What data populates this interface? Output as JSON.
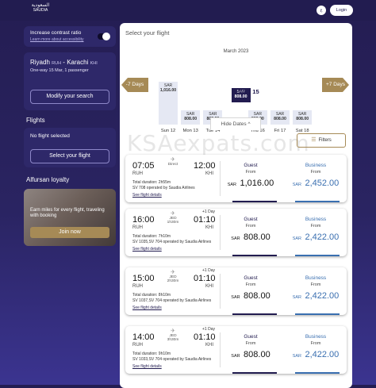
{
  "header": {
    "logo_ar": "السعودية",
    "logo_en": "SAUDIA",
    "lang_label": "ع",
    "login_label": "Login"
  },
  "sidebar": {
    "contrast_label": "Increase contrast ratio",
    "accessibility_link": "Learn more about accessibility",
    "route_from": "Riyadh",
    "route_from_code": "RUH",
    "route_sep": "-",
    "route_to": "Karachi",
    "route_to_code": "KHI",
    "trip_info": "One-way 15 Mar, 1 passenger",
    "modify_label": "Modify your search",
    "flights_title": "Flights",
    "no_flight": "No flight selected",
    "select_flight_btn": "Select your flight",
    "loyalty_title": "Alfursan loyalty",
    "loyalty_text": "Earn miles for every flight, traveling with booking",
    "join_label": "Join now"
  },
  "main": {
    "title": "Select your flight",
    "month": "March 2023",
    "prev_label": "-7 Days",
    "next_label": "+7 Days",
    "hide_dates": "Hide Dates ^",
    "filters_label": "Filters",
    "filters_icon": "sliders-icon",
    "watermark": "KSAexpats.com",
    "dates": [
      {
        "cur": "SAR",
        "price": "1,016.00",
        "label": "Sun 12",
        "level": 1.0,
        "selected": false
      },
      {
        "cur": "SAR",
        "price": "808.00",
        "label": "Mon 13",
        "level": 0.33,
        "selected": false
      },
      {
        "cur": "SAR",
        "price": "808.00",
        "label": "Tue 14",
        "level": 0.33,
        "selected": false
      },
      {
        "cur": "SAR",
        "price": "808.00",
        "label": "Wed 15",
        "level": 0.33,
        "selected": true
      },
      {
        "cur": "SAR",
        "price": "808.00",
        "label": "Thu 16",
        "level": 0.33,
        "selected": false
      },
      {
        "cur": "SAR",
        "price": "808.00",
        "label": "Fri 17",
        "level": 0.33,
        "selected": false
      },
      {
        "cur": "SAR",
        "price": "808.00",
        "label": "Sat 18",
        "level": 0.33,
        "selected": false
      }
    ]
  },
  "flights": [
    {
      "dep_time": "07:05",
      "dep_code": "RUH",
      "arr_time": "12:00",
      "arr_code": "KHI",
      "plus_day": "",
      "stop": "Direct",
      "stop_city": "",
      "stop_dur": "",
      "duration": "Total duration: 2h55m",
      "operated": "SV 708 operated by Saudia Airlines",
      "see": "See flight details",
      "guest_label": "Guest",
      "guest_from": "From",
      "guest_cur": "SAR",
      "guest_price": "1,016.00",
      "bus_label": "Business",
      "bus_from": "From",
      "bus_cur": "SAR",
      "bus_price": "2,452.00"
    },
    {
      "dep_time": "16:00",
      "dep_code": "RUH",
      "arr_time": "01:10",
      "arr_code": "KHI",
      "plus_day": "+1 Day",
      "stop": "",
      "stop_city": "JED",
      "stop_dur": "1h30m",
      "duration": "Total duration: 7h10m",
      "operated": "SV 1035,SV 704 operated by Saudia Airlines",
      "see": "See flight details",
      "guest_label": "Guest",
      "guest_from": "From",
      "guest_cur": "SAR",
      "guest_price": "808.00",
      "bus_label": "Business",
      "bus_from": "From",
      "bus_cur": "SAR",
      "bus_price": "2,422.00"
    },
    {
      "dep_time": "15:00",
      "dep_code": "RUH",
      "arr_time": "01:10",
      "arr_code": "KHI",
      "plus_day": "+1 Day",
      "stop": "",
      "stop_city": "JED",
      "stop_dur": "2h30m",
      "duration": "Total duration: 8h10m",
      "operated": "SV 1037,SV 704 operated by Saudia Airlines",
      "see": "See flight details",
      "guest_label": "Guest",
      "guest_from": "From",
      "guest_cur": "SAR",
      "guest_price": "808.00",
      "bus_label": "Business",
      "bus_from": "From",
      "bus_cur": "SAR",
      "bus_price": "2,422.00"
    },
    {
      "dep_time": "14:00",
      "dep_code": "RUH",
      "arr_time": "01:10",
      "arr_code": "KHI",
      "plus_day": "+1 Day",
      "stop": "",
      "stop_city": "JED",
      "stop_dur": "3h30m",
      "duration": "Total duration: 9h10m",
      "operated": "SV 1033,SV 704 operated by Saudia Airlines",
      "see": "See flight details",
      "guest_label": "Guest",
      "guest_from": "From",
      "guest_cur": "SAR",
      "guest_price": "808.00",
      "bus_label": "Business",
      "bus_from": "From",
      "bus_cur": "SAR",
      "bus_price": "2,422.00"
    }
  ]
}
